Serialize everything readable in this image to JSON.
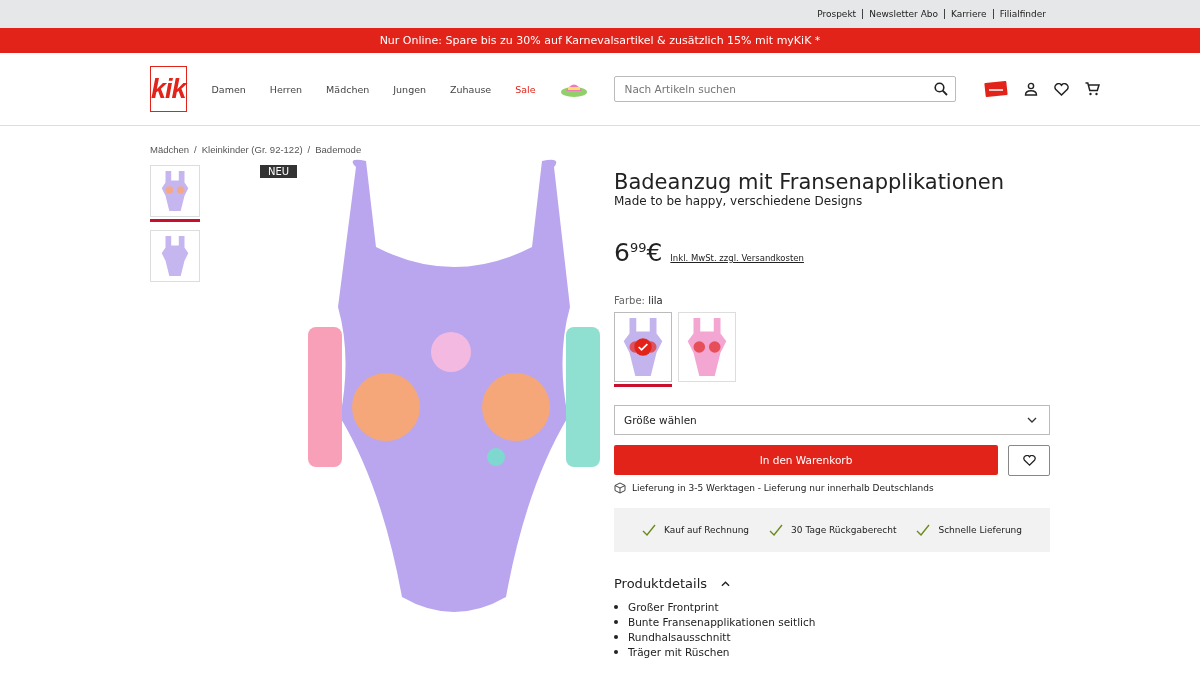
{
  "top_links": [
    "Prospekt",
    "Newsletter Abo",
    "Karriere",
    "Filialfinder"
  ],
  "promo": "Nur Online: Spare bis zu 30% auf Karnevalsartikel & zusätzlich 15% mit myKiK *",
  "logo": "kik",
  "nav": [
    {
      "label": "Damen",
      "highlighted": false
    },
    {
      "label": "Herren",
      "highlighted": false
    },
    {
      "label": "Mädchen",
      "highlighted": false
    },
    {
      "label": "Jungen",
      "highlighted": false
    },
    {
      "label": "Zuhause",
      "highlighted": false
    },
    {
      "label": "Sale",
      "highlighted": true
    }
  ],
  "search": {
    "placeholder": "Nach Artikeln suchen"
  },
  "breadcrumb": {
    "separator": "/",
    "items": [
      "Mädchen",
      "Kleinkinder (Gr. 92-122)",
      "Bademode"
    ]
  },
  "thumbnails": [
    {
      "selected": true
    },
    {
      "selected": false
    }
  ],
  "badge": "NEU",
  "product": {
    "title": "Badeanzug mit Fransenapplikationen",
    "subtitle": "Made to be happy, verschiedene Designs",
    "price": {
      "euros": "6",
      "cents": "99",
      "currency": "€"
    },
    "tax_note": "Inkl. MwSt. zzgl. Versandkosten",
    "color_label": "Farbe:",
    "color_value": "lila",
    "swatches": [
      {
        "selected": true,
        "color": "#c3b4ee"
      },
      {
        "selected": false,
        "color": "#f4a6d2"
      }
    ],
    "size_select": {
      "placeholder": "Größe wählen"
    },
    "cart_button": "In den Warenkorb",
    "delivery": "Lieferung in 3-5 Werktagen - Lieferung nur innerhalb Deutschlands",
    "benefits": [
      "Kauf auf Rechnung",
      "30 Tage Rückgaberecht",
      "Schnelle Lieferung"
    ],
    "details": {
      "heading": "Produktdetails",
      "expanded": true,
      "items": [
        "Großer Frontprint",
        "Bunte Fransenapplikationen seitlich",
        "Rundhalsausschnitt",
        "Träger mit Rüschen"
      ]
    }
  }
}
